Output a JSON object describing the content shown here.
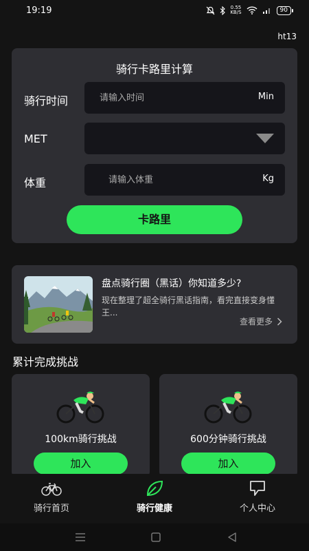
{
  "status_bar": {
    "time": "19:19",
    "net_speed_top": "0.55",
    "net_speed_bottom": "KB/S",
    "battery": "90"
  },
  "user_tag": "ht13",
  "calculator": {
    "title": "骑行卡路里计算",
    "time_label": "骑行时间",
    "time_placeholder": "请输入时间",
    "time_unit": "Min",
    "met_label": "MET",
    "weight_label": "体重",
    "weight_placeholder": "请输入体重",
    "weight_unit": "Kg",
    "button_label": "卡路里"
  },
  "article": {
    "title": "盘点骑行圈（黑话）你知道多少?",
    "description": "现在整理了超全骑行黑话指南，看完直接变身懂王...",
    "more_label": "查看更多"
  },
  "challenges_section": {
    "title": "累计完成挑战",
    "items": [
      {
        "name": "100km骑行挑战",
        "button": "加入"
      },
      {
        "name": "600分钟骑行挑战",
        "button": "加入"
      }
    ]
  },
  "tab_bar": {
    "tabs": [
      {
        "label": "骑行首页",
        "icon": "bicycle-icon",
        "active": false
      },
      {
        "label": "骑行健康",
        "icon": "leaf-icon",
        "active": true
      },
      {
        "label": "个人中心",
        "icon": "chat-bubble-icon",
        "active": false
      }
    ]
  },
  "colors": {
    "accent": "#2ee55a",
    "background": "#141414",
    "card": "#2e2e33"
  }
}
